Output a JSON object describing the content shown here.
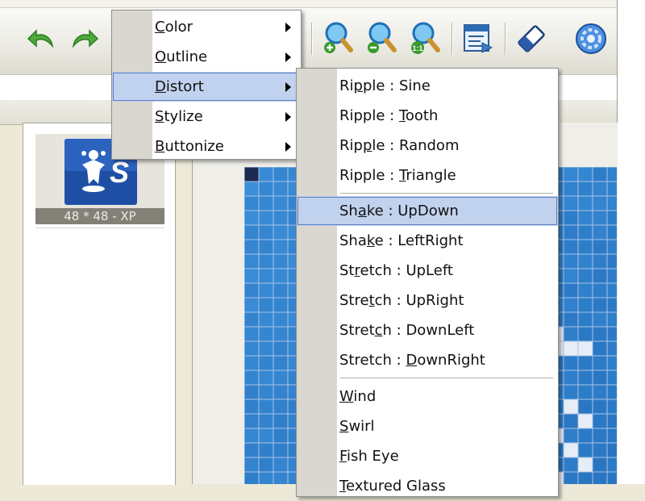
{
  "toolbar": {
    "icons": [
      "undo-icon",
      "redo-icon",
      "zoom-in-icon",
      "zoom-out-icon",
      "zoom-actual-icon",
      "preview-icon",
      "eraser-icon",
      "settings-icon"
    ],
    "zoom_actual_text": "1:1"
  },
  "thumbnail": {
    "label": "48 * 48 - XP",
    "glyph": "S"
  },
  "effects_menu": {
    "items": [
      {
        "label": "Color",
        "key": "C",
        "rest": "olor"
      },
      {
        "label": "Outline",
        "key": "O",
        "rest": "utline"
      },
      {
        "label": "Distort",
        "key": "D",
        "rest": "istort"
      },
      {
        "label": "Stylize",
        "key": "S",
        "rest": "tylize"
      },
      {
        "label": "Buttonize",
        "key": "B",
        "rest": "uttonize"
      }
    ]
  },
  "distort_menu": {
    "items": [
      {
        "pre": "Ri",
        "key": "p",
        "post": "ple : Sine"
      },
      {
        "pre": "Ripple : ",
        "key": "T",
        "post": "ooth"
      },
      {
        "pre": "Rip",
        "key": "p",
        "post": "le : Random"
      },
      {
        "pre": "Ripple : ",
        "key": "T",
        "post": "riangle"
      },
      {
        "pre": "Sh",
        "key": "a",
        "post": "ke : UpDown"
      },
      {
        "pre": "Sha",
        "key": "k",
        "post": "e : LeftRight"
      },
      {
        "pre": "St",
        "key": "r",
        "post": "etch : UpLeft"
      },
      {
        "pre": "Stre",
        "key": "t",
        "post": "ch : UpRight"
      },
      {
        "pre": "Stret",
        "key": "c",
        "post": "h : DownLeft"
      },
      {
        "pre": "Stretch : ",
        "key": "D",
        "post": "ownRight"
      },
      {
        "pre": "",
        "key": "W",
        "post": "ind"
      },
      {
        "pre": "",
        "key": "S",
        "post": "wirl"
      },
      {
        "pre": "",
        "key": "F",
        "post": "ish Eye"
      },
      {
        "pre": "",
        "key": "T",
        "post": "extured Glass"
      }
    ]
  }
}
